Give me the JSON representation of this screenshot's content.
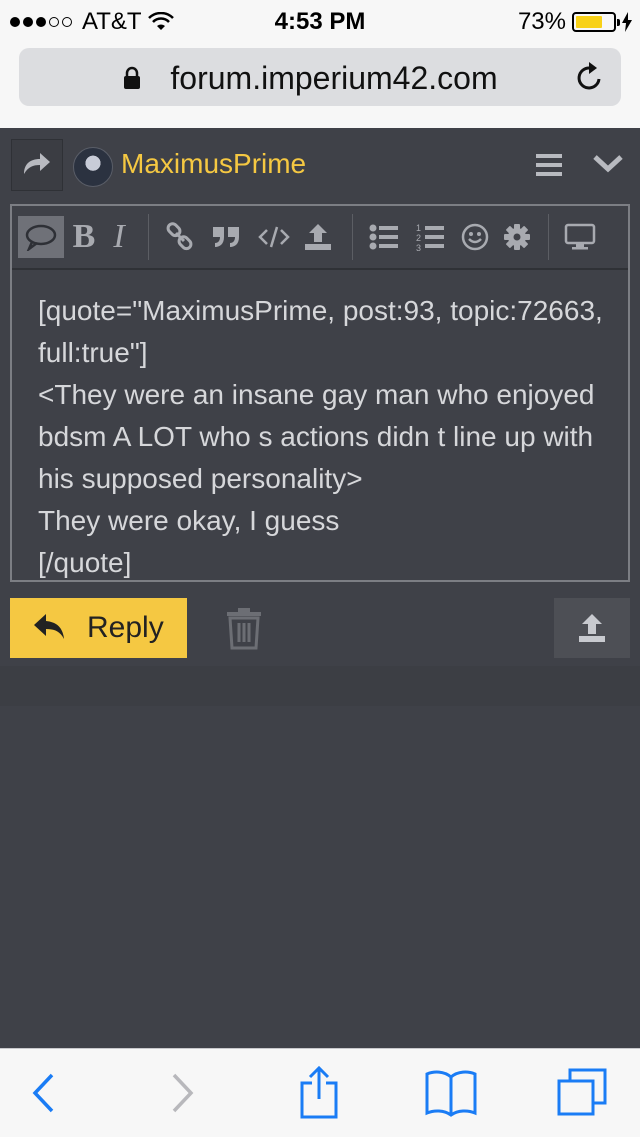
{
  "status_bar": {
    "carrier": "AT&T",
    "time": "4:53 PM",
    "battery_percent": "73%",
    "battery_level": 0.73,
    "battery_color": "#f8d117"
  },
  "browser": {
    "url": "forum.imperium42.com"
  },
  "composer": {
    "username": "MaximusPrime",
    "accent_color": "#f5c842",
    "toolbar": {
      "bold_label": "B",
      "italic_label": "I"
    },
    "text": "[quote=\"MaximusPrime, post:93, topic:72663, full:true\"]\n<They were an insane gay man who enjoyed bdsm A LOT who s actions didn t line up with his supposed personality>\nThey were okay, I guess\n[/quote]",
    "reply_label": "Reply"
  },
  "icons": {
    "lock": "lock-icon",
    "reload": "reload-icon",
    "share": "share-arrow-icon",
    "menu": "hamburger-icon",
    "chevron": "chevron-down-icon",
    "speech": "speech-bubble-icon",
    "link": "link-icon",
    "quote": "quote-icon",
    "code": "code-icon",
    "upload": "upload-icon",
    "bullet_list": "bullet-list-icon",
    "numbered_list": "numbered-list-icon",
    "emoji": "smiley-icon",
    "settings": "gear-icon",
    "preview": "monitor-icon",
    "trash": "trash-icon",
    "back": "back-chevron-icon",
    "forward": "forward-chevron-icon",
    "share_sheet": "share-sheet-icon",
    "bookmarks": "book-icon",
    "tabs": "tabs-icon"
  }
}
